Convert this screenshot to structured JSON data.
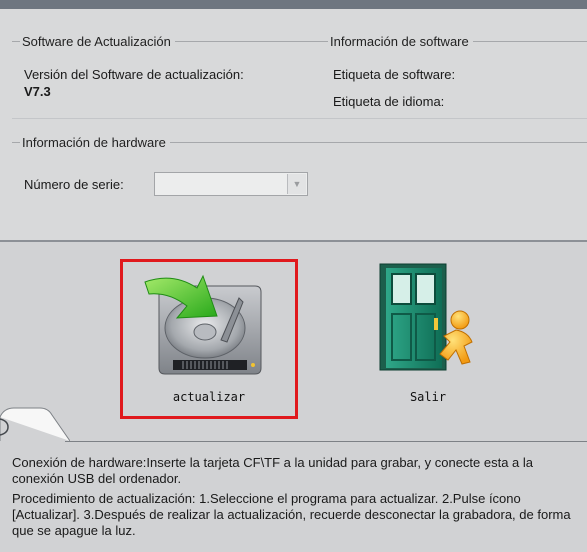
{
  "software_update": {
    "group_title": "Software de Actualización",
    "version_label": "Versión del Software de actualización:",
    "version_value": "V7.3"
  },
  "software_info": {
    "group_title": "Información de software",
    "software_tag_label": "Etiqueta de software:",
    "language_tag_label": "Etiqueta de idioma:"
  },
  "hardware_info": {
    "group_title": "Información de hardware",
    "serial_label": "Número de serie:",
    "serial_value": ""
  },
  "actions": {
    "update_label": "actualizar",
    "exit_label": "Salir"
  },
  "notes": {
    "hardware_connection": "Conexión de hardware:Inserte la tarjeta CF\\TF a la unidad para grabar, y conecte esta a la conexión USB del ordenador.",
    "update_procedure": "Procedimiento de actualización: 1.Seleccione el programa para actualizar. 2.Pulse ícono [Actualizar].  3.Después de realizar la actualización, recuerde desconectar la grabadora, de forma que se apague la luz."
  },
  "icons": {
    "update": "hard-drive-with-green-arrow-icon",
    "exit": "green-door-with-running-person-icon"
  },
  "colors": {
    "selection_border": "#e0191d",
    "title_bar": "#6e7680"
  }
}
